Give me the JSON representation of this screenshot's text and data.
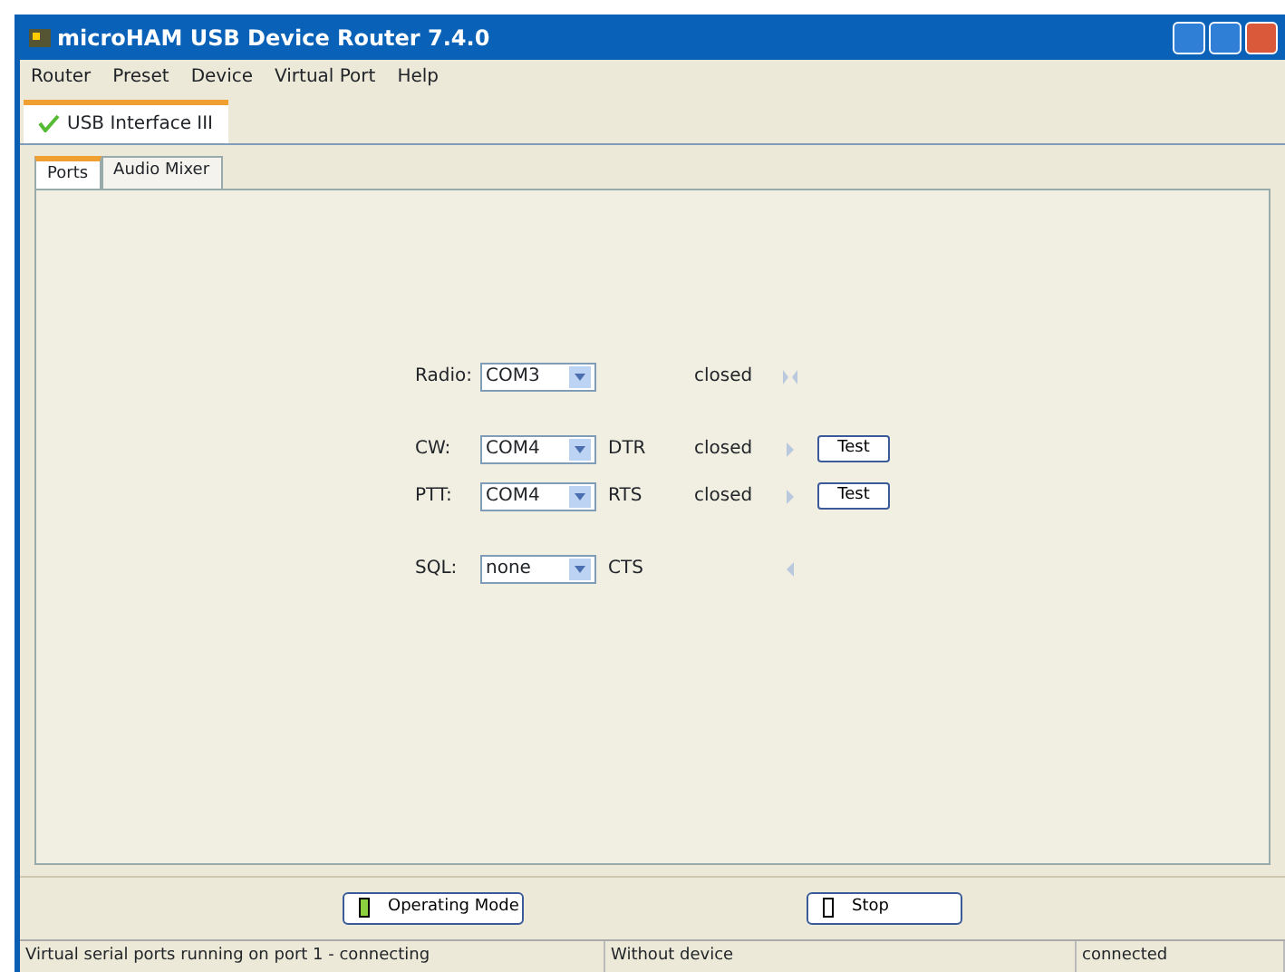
{
  "window": {
    "title": "microHAM USB Device Router 7.4.0"
  },
  "menu": [
    "Router",
    "Preset",
    "Device",
    "Virtual Port",
    "Help"
  ],
  "device_tabs": [
    {
      "label": "USB Interface III",
      "selected": true,
      "connected": true
    }
  ],
  "tabs": [
    {
      "label": "Ports",
      "selected": true
    },
    {
      "label": "Audio Mixer",
      "selected": false
    }
  ],
  "port_rows": [
    {
      "label": "Radio:",
      "port": "COM3",
      "state": "closed",
      "kind": "both"
    },
    {
      "label": "CW:",
      "port": "COM4",
      "signal": "DTR",
      "state": "closed",
      "kind": "right",
      "button": "Test"
    },
    {
      "label": "PTT:",
      "port": "COM4",
      "signal": "RTS",
      "state": "closed",
      "kind": "right",
      "button": "Test"
    },
    {
      "label": "SQL:",
      "port": "none",
      "signal": "CTS",
      "kind": "left"
    }
  ],
  "buttons": [
    {
      "label": "Operating Mode",
      "led_on": true
    },
    {
      "label": "Stop",
      "led_on": false
    }
  ],
  "status_bar": [
    "Virtual serial ports running on port 1 - connecting",
    "Without device",
    "connected"
  ]
}
